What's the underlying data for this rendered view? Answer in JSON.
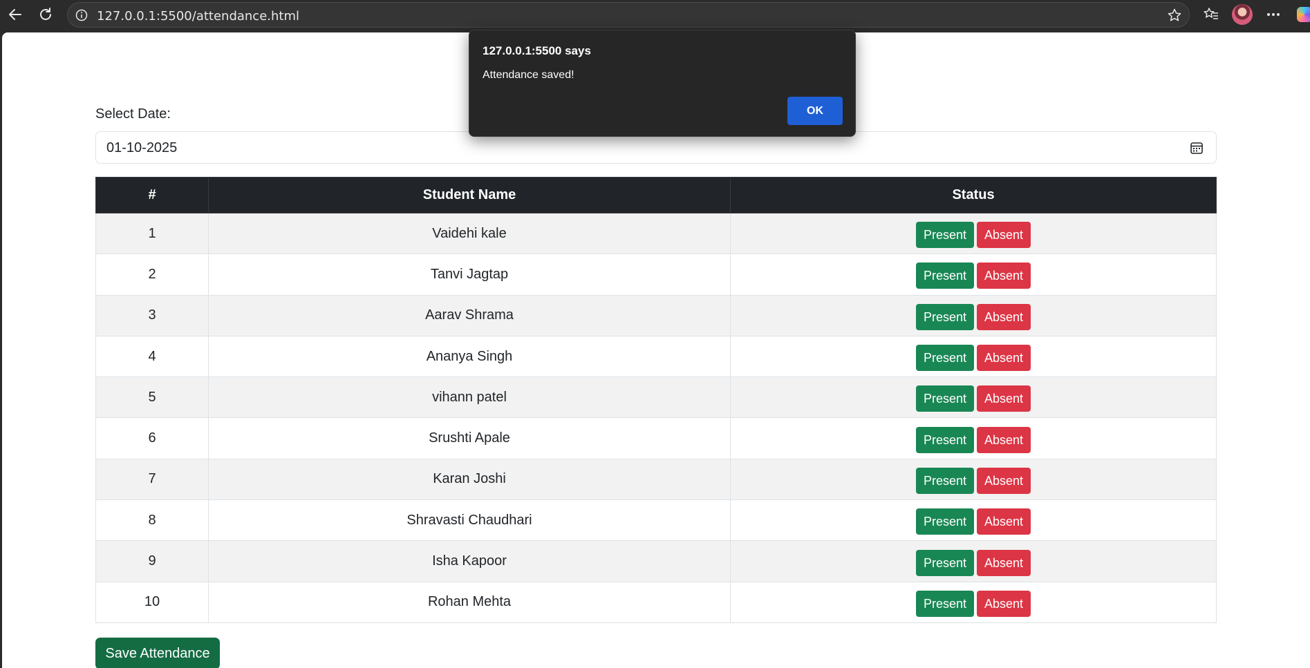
{
  "browser": {
    "url": "127.0.0.1:5500/attendance.html",
    "icons": [
      "back-arrow-icon",
      "refresh-icon",
      "info-icon",
      "star-icon",
      "favorites-icon",
      "profile-avatar",
      "more-icon",
      "copilot-icon"
    ]
  },
  "page": {
    "date_label": "Select Date:",
    "date_value": "01-10-2025",
    "table": {
      "headers": [
        "#",
        "Student Name",
        "Status"
      ],
      "rows": [
        {
          "num": "1",
          "name": "Vaidehi kale"
        },
        {
          "num": "2",
          "name": "Tanvi Jagtap"
        },
        {
          "num": "3",
          "name": "Aarav Shrama"
        },
        {
          "num": "4",
          "name": "Ananya Singh"
        },
        {
          "num": "5",
          "name": "vihann patel"
        },
        {
          "num": "6",
          "name": "Srushti Apale"
        },
        {
          "num": "7",
          "name": "Karan Joshi"
        },
        {
          "num": "8",
          "name": "Shravasti Chaudhari"
        },
        {
          "num": "9",
          "name": "Isha Kapoor"
        },
        {
          "num": "10",
          "name": "Rohan Mehta"
        }
      ],
      "present_label": "Present",
      "absent_label": "Absent"
    },
    "save_label": "Save Attendance"
  },
  "dialog": {
    "title": "127.0.0.1:5500 says",
    "message": "Attendance saved!",
    "ok_label": "OK"
  },
  "colors": {
    "present": "#198754",
    "absent": "#dc3545",
    "header_bg": "#212529",
    "ok_button": "#1f5fd6"
  }
}
